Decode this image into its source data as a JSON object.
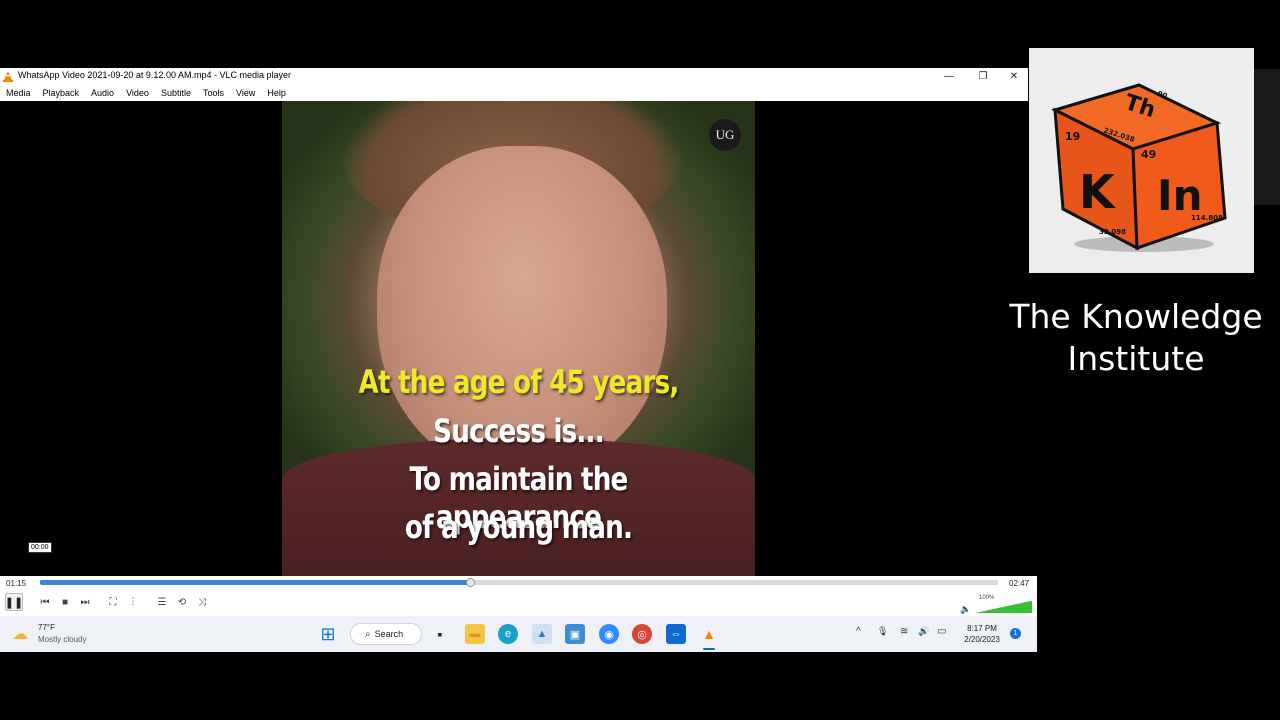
{
  "vlc": {
    "window_title": "WhatsApp Video 2021-09-20 at 9.12.00 AM.mp4 - VLC media player",
    "minimize_glyph": "—",
    "maximize_glyph": "❐",
    "close_glyph": "✕",
    "menus": [
      "Media",
      "Playback",
      "Audio",
      "Video",
      "Subtitle",
      "Tools",
      "View",
      "Help"
    ],
    "video": {
      "watermark": "UG",
      "caption_lines": [
        "At the age of 45 years,",
        "Success is...",
        "To maintain the appearance",
        "of a young man."
      ]
    },
    "seek_tooltip": "00:00",
    "elapsed": "01:15",
    "duration": "02:47",
    "progress_fraction": 0.449,
    "volume_percent_label": "100%",
    "volume_fraction": 1.0,
    "controls": {
      "pause_glyph": "❚❚",
      "prev_glyph": "⏮",
      "stop_glyph": "■",
      "next_glyph": "⏭",
      "fullscreen_glyph": "⛶",
      "extended_glyph": "⫶",
      "playlist_glyph": "☰",
      "loop_glyph": "⟲",
      "random_glyph": "⤨",
      "volume_glyph": "🔈"
    }
  },
  "taskbar": {
    "temperature": "77°F",
    "condition": "Mostly cloudy",
    "search_label": "Search",
    "time": "8:17 PM",
    "date": "2/20/2023",
    "notification_count": "1",
    "icons": {
      "weather": "☁",
      "windows": "⊞",
      "search": "⌕",
      "taskview": "▪",
      "explorer": "▬",
      "edge": "e",
      "photos": "▲",
      "screen": "▣",
      "zoom": "◉",
      "chrome": "◎",
      "teamviewer": "⇔",
      "vlc": "▲",
      "chevron": "^",
      "mic": "🎙",
      "wifi": "≋",
      "speaker": "🔊",
      "battery": "▭"
    }
  },
  "brand": {
    "name_line1": "The Knowledge",
    "name_line2": "Institute",
    "cube_labels": {
      "top_symbol": "Th",
      "top_mass": "232.038",
      "top_number": "90",
      "left_symbol": "K",
      "left_number": "19",
      "left_mass": "39.098",
      "right_symbol": "In",
      "right_number": "49",
      "right_mass": "114.808"
    }
  },
  "colors": {
    "seek_fill": "#3d84d3",
    "cube_orange": "#f05a1a",
    "caption_yellow": "#f0e82a"
  }
}
